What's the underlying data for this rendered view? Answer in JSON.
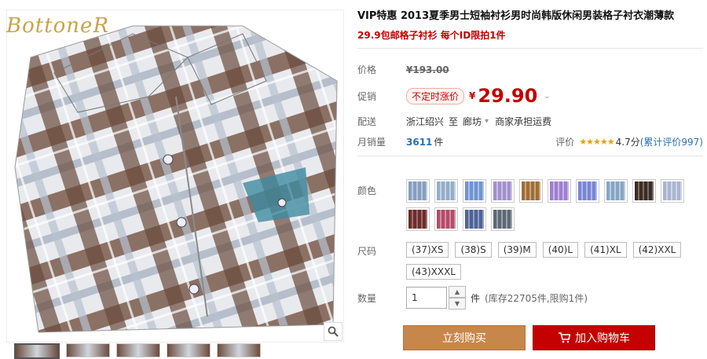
{
  "gallery": {
    "brand": "BottoneR",
    "zoom_icon": "magnifier-icon"
  },
  "product": {
    "title": "VIP特惠 2013夏季男士短袖衬衫男时尚韩版休闲男装格子衬衣潮薄款",
    "subtitle": "29.9包邮格子衬衫 每个ID限拍1件"
  },
  "price": {
    "label": "价格",
    "original": "¥193.00"
  },
  "promo": {
    "label": "促销",
    "tag": "不定时涨价",
    "currency": "¥",
    "value": "29.90"
  },
  "shipping": {
    "label": "配送",
    "from": "浙江绍兴",
    "to_word": "至",
    "dest": "廊坊",
    "fee": "商家承担运费"
  },
  "sales": {
    "label": "月销量",
    "count": "3611",
    "unit": "件",
    "rating_label": "评价",
    "stars": "★★★★★",
    "score": "4.7分",
    "reviews": "(累计评价997)"
  },
  "colors": {
    "label": "颜色",
    "swatches": [
      "#b9c9dc",
      "#c3d2e3",
      "#a9c2e6",
      "#cbbfe4",
      "#c9a77a",
      "#c9b4e6",
      "#aeb9e8",
      "#b8cde0",
      "#7b6b63",
      "#d0d6e6",
      "#a46b6b",
      "#d58ca4",
      "#8f9fc4",
      "#9aa3ad"
    ]
  },
  "sizes": {
    "label": "尺码",
    "options": [
      "(37)XS",
      "(38)S",
      "(39)M",
      "(40)L",
      "(41)XL",
      "(42)XXL",
      "(43)XXXL"
    ]
  },
  "quantity": {
    "label": "数量",
    "value": "1",
    "unit": "件",
    "stock": "(库存22705件,限购1件)"
  },
  "actions": {
    "buy": "立刻购买",
    "cart": "加入购物车"
  }
}
